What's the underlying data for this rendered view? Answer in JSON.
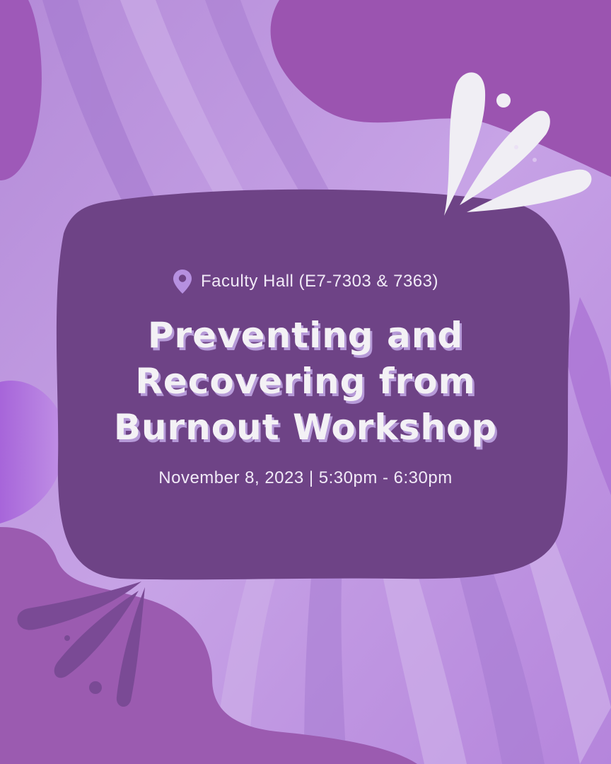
{
  "event": {
    "location": "Faculty Hall (E7-7303 & 7363)",
    "title_lines": [
      "Preventing and",
      "Recovering from",
      "Burnout Workshop"
    ],
    "datetime": "November 8, 2023 | 5:30pm - 6:30pm"
  },
  "icons": {
    "location": "map-pin-icon"
  },
  "colors": {
    "background": "#b98ed9",
    "panel": "#6e4386",
    "accent_blob": "#9b54b0",
    "text": "#f3f1f5",
    "title_shadow": "#b69ad8"
  }
}
